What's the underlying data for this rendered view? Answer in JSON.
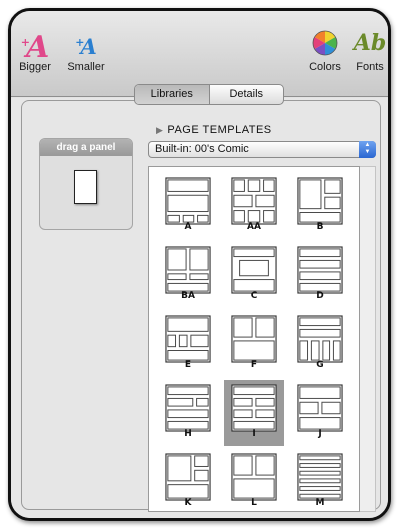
{
  "toolbar": {
    "bigger_label": "Bigger",
    "bigger_glyph": "A",
    "smaller_label": "Smaller",
    "smaller_glyph": "A",
    "colors_label": "Colors",
    "fonts_label": "Fonts",
    "fonts_glyph": "Ab"
  },
  "tabs": {
    "libraries": "Libraries",
    "details": "Details",
    "selected": "libraries"
  },
  "drag_panel": {
    "title": "drag a panel"
  },
  "section": {
    "title": "PAGE TEMPLATES"
  },
  "template_select": {
    "value": "Built-in: 00's Comic"
  },
  "templates": [
    {
      "name": "A",
      "icon": "template-a-icon"
    },
    {
      "name": "AA",
      "icon": "template-aa-icon"
    },
    {
      "name": "B",
      "icon": "template-b-icon"
    },
    {
      "name": "BA",
      "icon": "template-ba-icon"
    },
    {
      "name": "C",
      "icon": "template-c-icon"
    },
    {
      "name": "D",
      "icon": "template-d-icon"
    },
    {
      "name": "E",
      "icon": "template-e-icon"
    },
    {
      "name": "F",
      "icon": "template-f-icon"
    },
    {
      "name": "G",
      "icon": "template-g-icon"
    },
    {
      "name": "H",
      "icon": "template-h-icon"
    },
    {
      "name": "I",
      "icon": "template-i-icon",
      "selected": true
    },
    {
      "name": "J",
      "icon": "template-j-icon"
    },
    {
      "name": "K",
      "icon": "template-k-icon"
    },
    {
      "name": "L",
      "icon": "template-l-icon"
    },
    {
      "name": "M",
      "icon": "template-m-icon"
    }
  ]
}
